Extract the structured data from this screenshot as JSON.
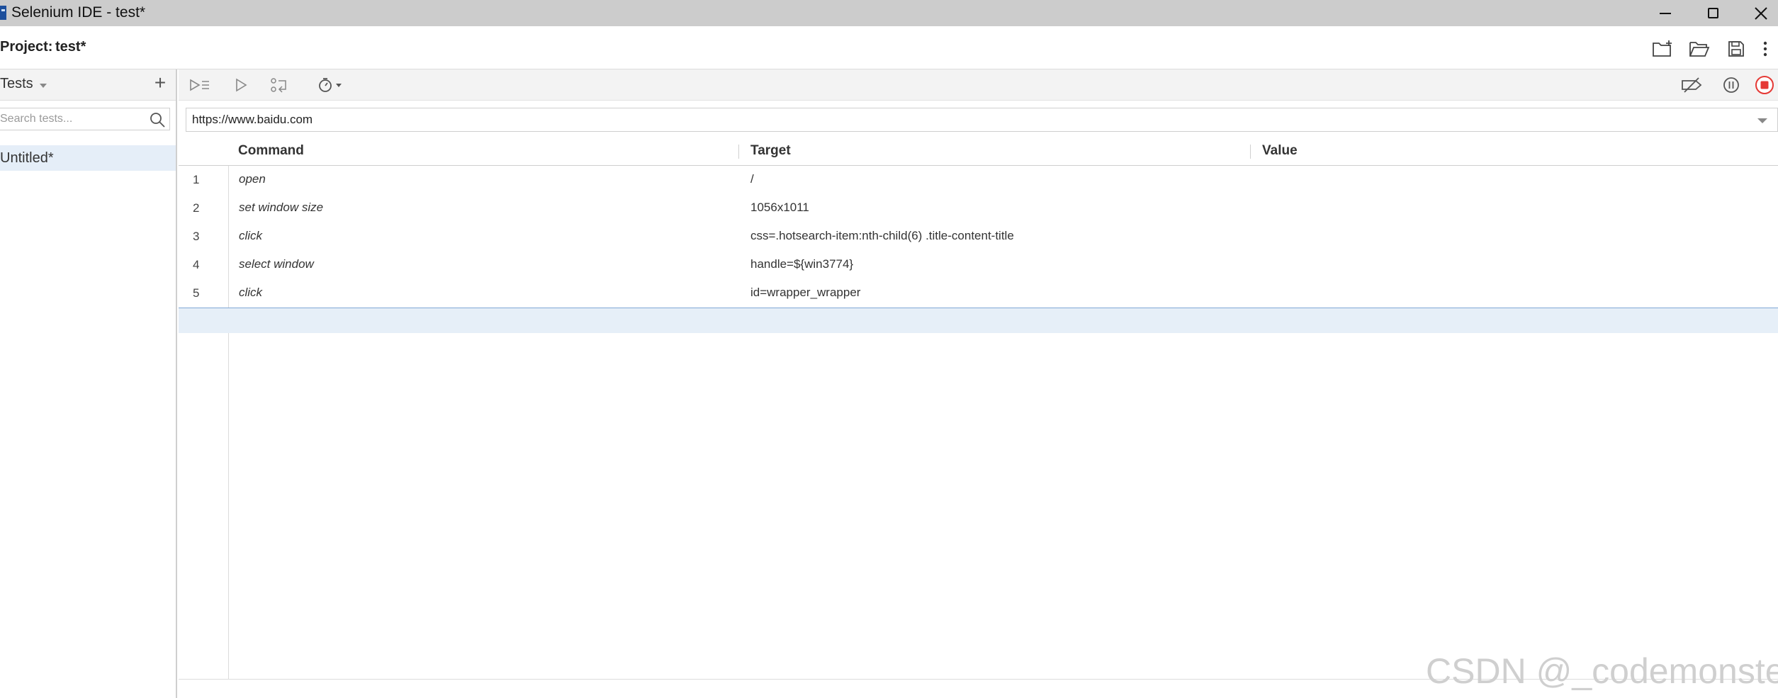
{
  "window": {
    "title": "Selenium IDE - test*"
  },
  "project": {
    "label": "Project:",
    "name": "test*"
  },
  "sidebar": {
    "tests_label": "Tests",
    "add_label": "+",
    "search_placeholder": "Search tests...",
    "tests": [
      {
        "name": "Untitled*"
      }
    ]
  },
  "url_bar": {
    "value": "https://www.baidu.com"
  },
  "table": {
    "headers": {
      "command": "Command",
      "target": "Target",
      "value": "Value"
    },
    "rows": [
      {
        "index": "1",
        "command": "open",
        "target": "/",
        "value": ""
      },
      {
        "index": "2",
        "command": "set window size",
        "target": "1056x1011",
        "value": ""
      },
      {
        "index": "3",
        "command": "click",
        "target": "css=.hotsearch-item:nth-child(6) .title-content-title",
        "value": ""
      },
      {
        "index": "4",
        "command": "select window",
        "target": "handle=${win3774}",
        "value": ""
      },
      {
        "index": "5",
        "command": "click",
        "target": "id=wrapper_wrapper",
        "value": ""
      }
    ]
  },
  "watermark": "CSDN @_codemonster",
  "colors": {
    "titlebar": "#cccccc",
    "selection": "#e6eff8",
    "record_red": "#e53935"
  }
}
